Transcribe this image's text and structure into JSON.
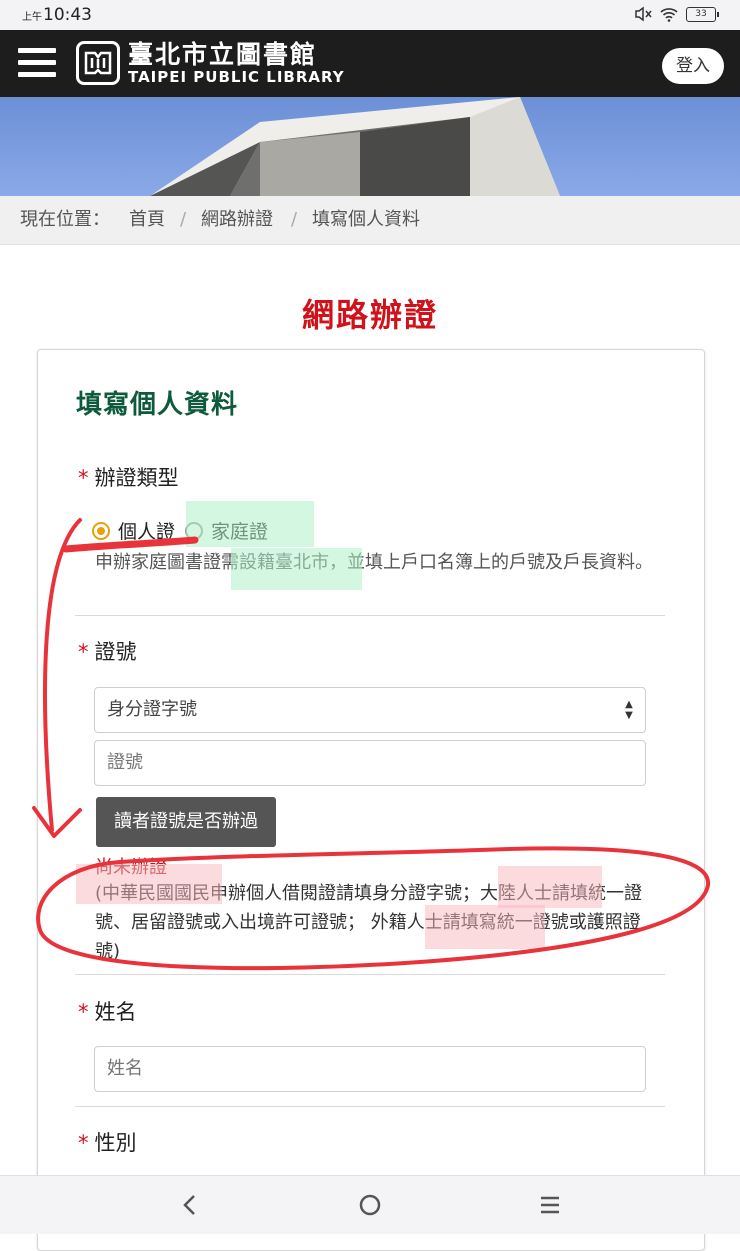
{
  "status_bar": {
    "ampm": "上午",
    "time": "10:43",
    "battery": "33"
  },
  "header": {
    "logo_zh": "臺北市立圖書館",
    "logo_en": "TAIPEI PUBLIC LIBRARY",
    "login_label": "登入"
  },
  "breadcrumb": {
    "prefix": "現在位置：",
    "items": [
      "首頁",
      "網路辦證",
      "填寫個人資料"
    ],
    "separator": "/"
  },
  "page_title": "網路辦證",
  "form": {
    "section_title": "填寫個人資料",
    "required_mark": "*",
    "card_type": {
      "label": "辦證類型",
      "options": [
        "個人證",
        "家庭證"
      ],
      "selected": "個人證",
      "help": "申辦家庭圖書證需設籍臺北市，並填上戶口名簿上的戶號及戶長資料。"
    },
    "id_number": {
      "label": "證號",
      "select_value": "身分證字號",
      "input_placeholder": "證號",
      "check_button": "讀者證號是否辦過",
      "status": "尚未辦證",
      "note": "(中華民國國民申辦個人借閱證請填身分證字號；大陸人士請填統一證號、居留證號或入出境許可證號； 外籍人士請填寫統一證號或護照證號)"
    },
    "name": {
      "label": "姓名",
      "placeholder": "姓名"
    },
    "gender": {
      "label": "性別"
    }
  },
  "colors": {
    "title_red": "#d0121b",
    "section_green": "#0e5a3c",
    "radio_checked": "#e6a10b",
    "annotation_red": "#e8333b",
    "highlight_green": "#aef0c8",
    "highlight_pink": "#f7b8bd"
  },
  "nav_icons": [
    "back-icon",
    "home-icon",
    "recent-apps-icon"
  ]
}
